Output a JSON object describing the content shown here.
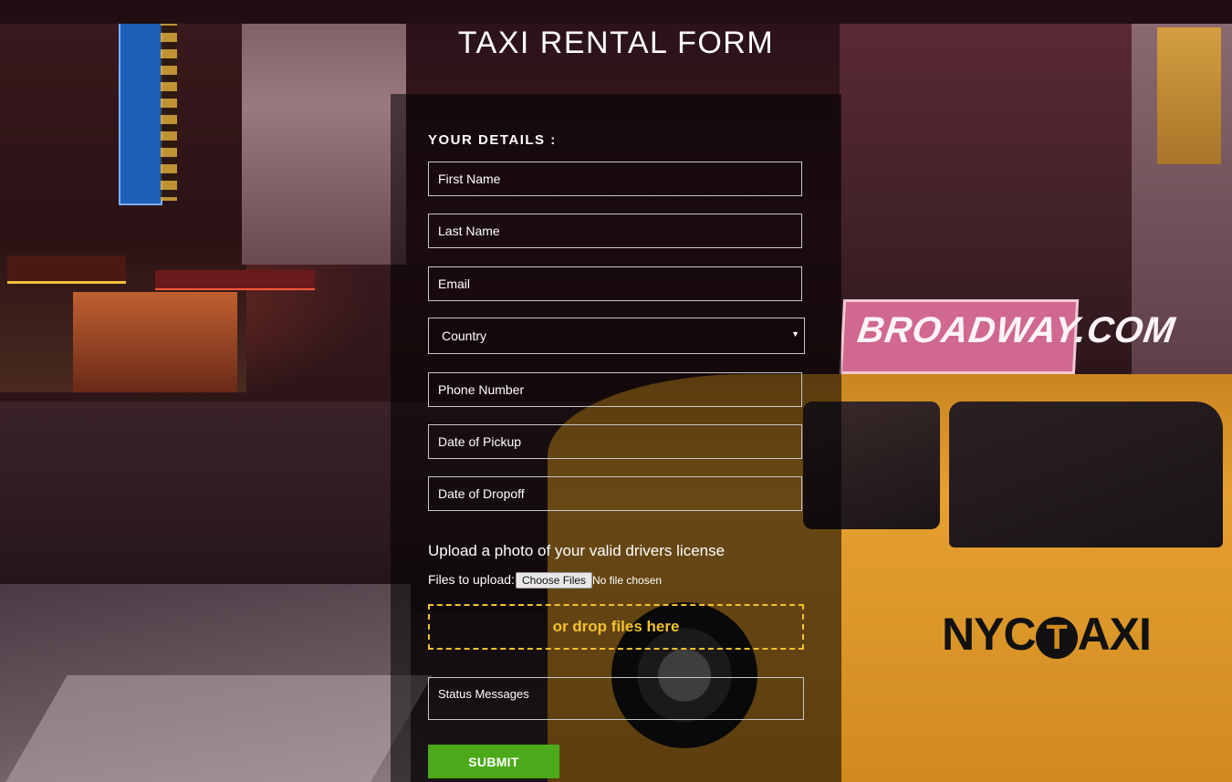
{
  "page": {
    "title": "TAXI RENTAL FORM"
  },
  "form": {
    "section_title": "YOUR DETAILS :",
    "fields": {
      "first_name": {
        "placeholder": "First Name"
      },
      "last_name": {
        "placeholder": "Last Name"
      },
      "email": {
        "placeholder": "Email"
      },
      "country": {
        "selected": "Country"
      },
      "phone": {
        "placeholder": "Phone Number"
      },
      "pickup": {
        "placeholder": "Date of Pickup"
      },
      "dropoff": {
        "placeholder": "Date of Dropoff"
      },
      "status": {
        "placeholder": "Status Messages"
      }
    },
    "upload": {
      "title": "Upload a photo of your valid drivers license",
      "files_label": "Files to upload:",
      "choose_button": "Choose Files",
      "no_file": "No file chosen",
      "drop_text": "or drop files here"
    },
    "submit_label": "SUBMIT"
  },
  "background": {
    "sign_broadway": "BROADWAY.COM",
    "sign_taxi_nyc": "NYC",
    "sign_taxi_t": "T",
    "sign_taxi_axi": "AXI"
  },
  "colors": {
    "accent_green": "#4caa1a",
    "drop_yellow": "#f2c230",
    "taxi_yellow": "#e5a030"
  },
  "icons": {
    "select_arrow": "caret-down-icon"
  }
}
